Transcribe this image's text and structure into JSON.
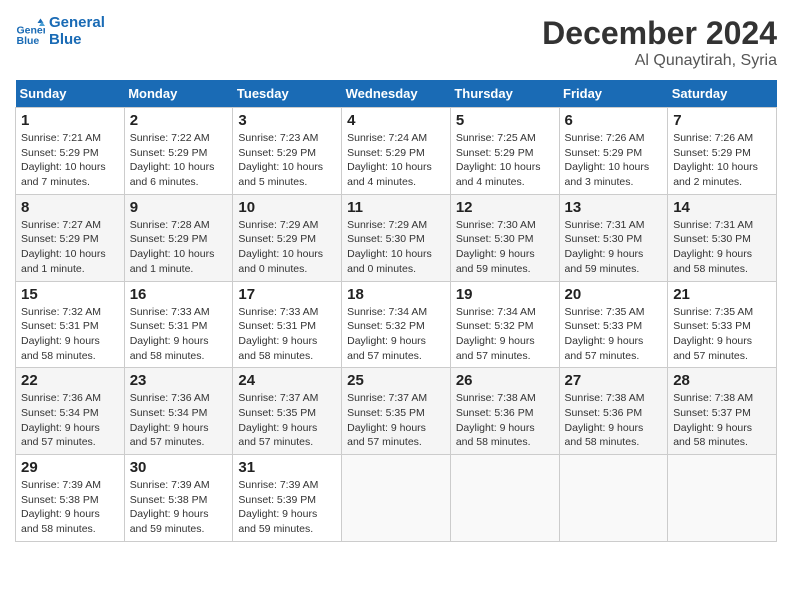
{
  "header": {
    "logo_line1": "General",
    "logo_line2": "Blue",
    "month": "December 2024",
    "location": "Al Qunaytirah, Syria"
  },
  "weekdays": [
    "Sunday",
    "Monday",
    "Tuesday",
    "Wednesday",
    "Thursday",
    "Friday",
    "Saturday"
  ],
  "weeks": [
    [
      {
        "day": "1",
        "sunrise": "7:21 AM",
        "sunset": "5:29 PM",
        "daylight": "10 hours and 7 minutes."
      },
      {
        "day": "2",
        "sunrise": "7:22 AM",
        "sunset": "5:29 PM",
        "daylight": "10 hours and 6 minutes."
      },
      {
        "day": "3",
        "sunrise": "7:23 AM",
        "sunset": "5:29 PM",
        "daylight": "10 hours and 5 minutes."
      },
      {
        "day": "4",
        "sunrise": "7:24 AM",
        "sunset": "5:29 PM",
        "daylight": "10 hours and 4 minutes."
      },
      {
        "day": "5",
        "sunrise": "7:25 AM",
        "sunset": "5:29 PM",
        "daylight": "10 hours and 4 minutes."
      },
      {
        "day": "6",
        "sunrise": "7:26 AM",
        "sunset": "5:29 PM",
        "daylight": "10 hours and 3 minutes."
      },
      {
        "day": "7",
        "sunrise": "7:26 AM",
        "sunset": "5:29 PM",
        "daylight": "10 hours and 2 minutes."
      }
    ],
    [
      {
        "day": "8",
        "sunrise": "7:27 AM",
        "sunset": "5:29 PM",
        "daylight": "10 hours and 1 minute."
      },
      {
        "day": "9",
        "sunrise": "7:28 AM",
        "sunset": "5:29 PM",
        "daylight": "10 hours and 1 minute."
      },
      {
        "day": "10",
        "sunrise": "7:29 AM",
        "sunset": "5:29 PM",
        "daylight": "10 hours and 0 minutes."
      },
      {
        "day": "11",
        "sunrise": "7:29 AM",
        "sunset": "5:30 PM",
        "daylight": "10 hours and 0 minutes."
      },
      {
        "day": "12",
        "sunrise": "7:30 AM",
        "sunset": "5:30 PM",
        "daylight": "9 hours and 59 minutes."
      },
      {
        "day": "13",
        "sunrise": "7:31 AM",
        "sunset": "5:30 PM",
        "daylight": "9 hours and 59 minutes."
      },
      {
        "day": "14",
        "sunrise": "7:31 AM",
        "sunset": "5:30 PM",
        "daylight": "9 hours and 58 minutes."
      }
    ],
    [
      {
        "day": "15",
        "sunrise": "7:32 AM",
        "sunset": "5:31 PM",
        "daylight": "9 hours and 58 minutes."
      },
      {
        "day": "16",
        "sunrise": "7:33 AM",
        "sunset": "5:31 PM",
        "daylight": "9 hours and 58 minutes."
      },
      {
        "day": "17",
        "sunrise": "7:33 AM",
        "sunset": "5:31 PM",
        "daylight": "9 hours and 58 minutes."
      },
      {
        "day": "18",
        "sunrise": "7:34 AM",
        "sunset": "5:32 PM",
        "daylight": "9 hours and 57 minutes."
      },
      {
        "day": "19",
        "sunrise": "7:34 AM",
        "sunset": "5:32 PM",
        "daylight": "9 hours and 57 minutes."
      },
      {
        "day": "20",
        "sunrise": "7:35 AM",
        "sunset": "5:33 PM",
        "daylight": "9 hours and 57 minutes."
      },
      {
        "day": "21",
        "sunrise": "7:35 AM",
        "sunset": "5:33 PM",
        "daylight": "9 hours and 57 minutes."
      }
    ],
    [
      {
        "day": "22",
        "sunrise": "7:36 AM",
        "sunset": "5:34 PM",
        "daylight": "9 hours and 57 minutes."
      },
      {
        "day": "23",
        "sunrise": "7:36 AM",
        "sunset": "5:34 PM",
        "daylight": "9 hours and 57 minutes."
      },
      {
        "day": "24",
        "sunrise": "7:37 AM",
        "sunset": "5:35 PM",
        "daylight": "9 hours and 57 minutes."
      },
      {
        "day": "25",
        "sunrise": "7:37 AM",
        "sunset": "5:35 PM",
        "daylight": "9 hours and 57 minutes."
      },
      {
        "day": "26",
        "sunrise": "7:38 AM",
        "sunset": "5:36 PM",
        "daylight": "9 hours and 58 minutes."
      },
      {
        "day": "27",
        "sunrise": "7:38 AM",
        "sunset": "5:36 PM",
        "daylight": "9 hours and 58 minutes."
      },
      {
        "day": "28",
        "sunrise": "7:38 AM",
        "sunset": "5:37 PM",
        "daylight": "9 hours and 58 minutes."
      }
    ],
    [
      {
        "day": "29",
        "sunrise": "7:39 AM",
        "sunset": "5:38 PM",
        "daylight": "9 hours and 58 minutes."
      },
      {
        "day": "30",
        "sunrise": "7:39 AM",
        "sunset": "5:38 PM",
        "daylight": "9 hours and 59 minutes."
      },
      {
        "day": "31",
        "sunrise": "7:39 AM",
        "sunset": "5:39 PM",
        "daylight": "9 hours and 59 minutes."
      },
      null,
      null,
      null,
      null
    ]
  ]
}
